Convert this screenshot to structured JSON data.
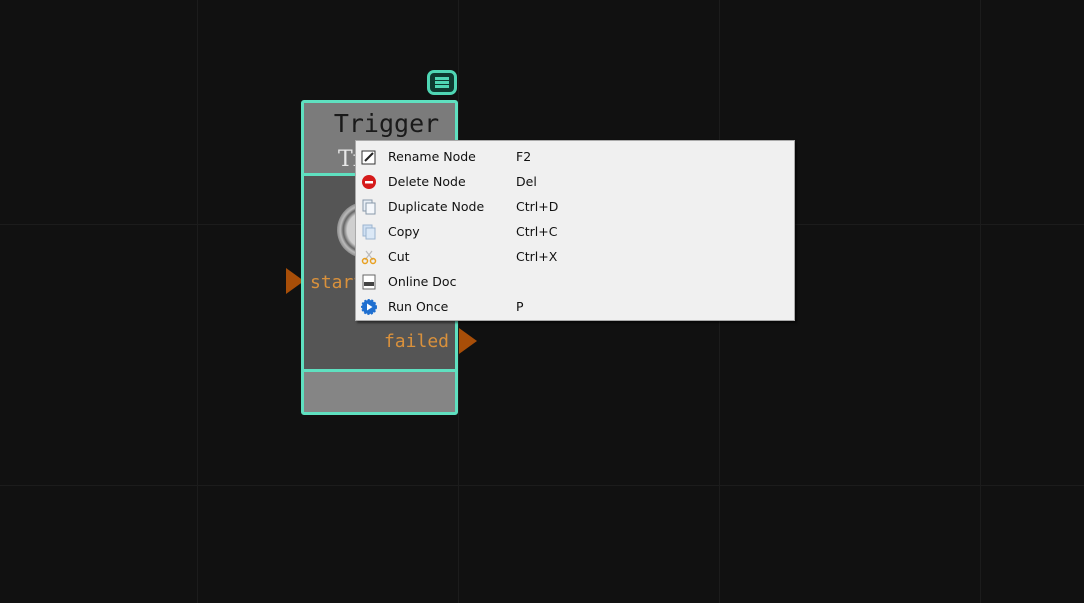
{
  "node": {
    "title": "Trigger",
    "subtitle": "Trigger",
    "inputs": [
      {
        "label": "start"
      }
    ],
    "outputs": [
      {
        "label": "failed"
      }
    ],
    "border_color": "#5fe0c0",
    "port_color": "#a84e08"
  },
  "context_menu": {
    "items": [
      {
        "label": "Rename Node",
        "shortcut": "F2",
        "icon": "rename-icon"
      },
      {
        "label": "Delete Node",
        "shortcut": "Del",
        "icon": "delete-icon"
      },
      {
        "label": "Duplicate Node",
        "shortcut": "Ctrl+D",
        "icon": "duplicate-icon"
      },
      {
        "label": "Copy",
        "shortcut": "Ctrl+C",
        "icon": "copy-icon"
      },
      {
        "label": "Cut",
        "shortcut": "Ctrl+X",
        "icon": "scissors-icon"
      },
      {
        "label": "Online Doc",
        "shortcut": "",
        "icon": "document-icon"
      },
      {
        "label": "Run Once",
        "shortcut": "P",
        "icon": "run-gear-icon"
      }
    ]
  }
}
